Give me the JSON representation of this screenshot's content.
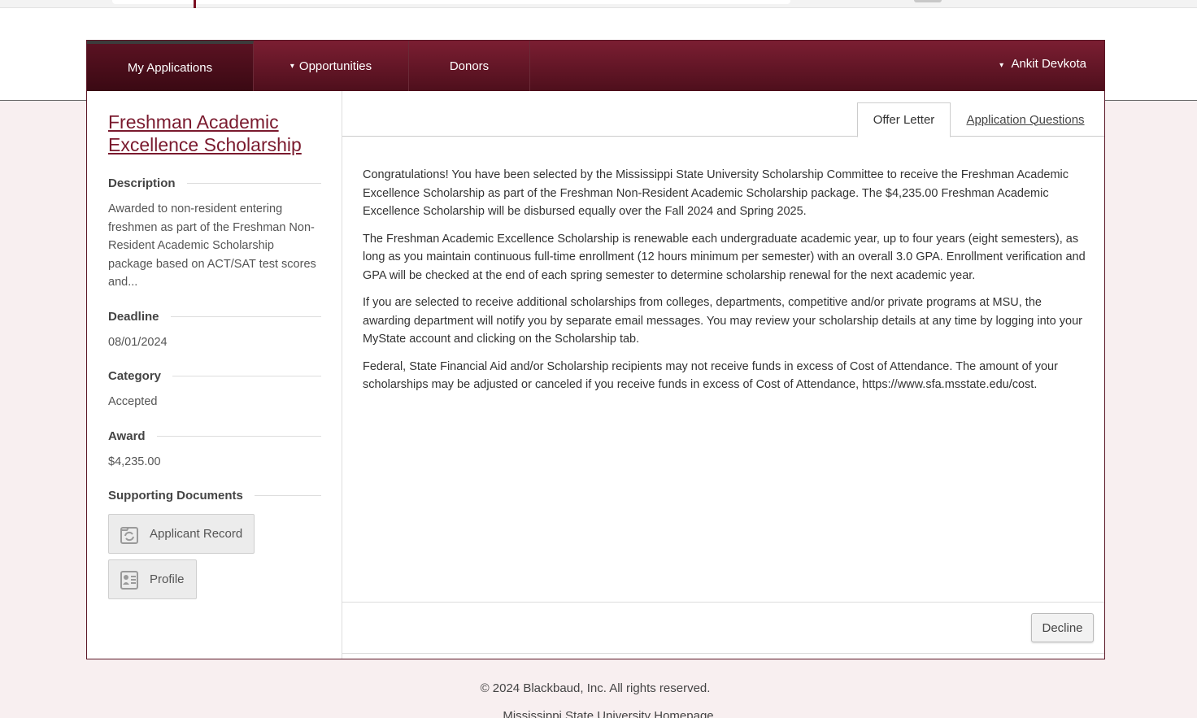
{
  "nav": {
    "items": [
      {
        "label": "My Applications",
        "dropdown": false,
        "active": true
      },
      {
        "label": "Opportunities",
        "dropdown": true,
        "active": false
      },
      {
        "label": "Donors",
        "dropdown": false,
        "active": false
      }
    ],
    "user": "Ankit Devkota",
    "caret": "▾"
  },
  "sidebar": {
    "title_line1": "Freshman Academic",
    "title_line2": "Excellence Scholarship",
    "description_heading": "Description",
    "description": "Awarded to non-resident entering freshmen as part of the Freshman Non-Resident Academic Scholarship package based on ACT/SAT test scores and...",
    "deadline_heading": "Deadline",
    "deadline": "08/01/2024",
    "category_heading": "Category",
    "category": "Accepted",
    "award_heading": "Award",
    "award": "$4,235.00",
    "docs_heading": "Supporting Documents",
    "docs": [
      "Applicant Record",
      "Profile"
    ]
  },
  "tabs": {
    "active": "Offer Letter",
    "other": "Application Questions"
  },
  "letter": {
    "p1": "Congratulations! You have been selected by the Mississippi State University Scholarship Committee to receive the Freshman Academic Excellence Scholarship as part of the Freshman Non-Resident Academic Scholarship package. The $4,235.00 Freshman Academic Excellence Scholarship will be disbursed equally over the Fall 2024 and Spring 2025.",
    "p2": "The Freshman Academic Excellence Scholarship is renewable each undergraduate academic year, up to four years (eight semesters), as long as you maintain continuous full-time enrollment (12 hours minimum per semester) with an overall 3.0 GPA. Enrollment verification and GPA will be checked at the end of each spring semester to determine scholarship renewal for the next academic year.",
    "p3": "If you are selected to receive additional scholarships from colleges, departments, competitive and/or private programs at MSU, the awarding department will notify you by separate email messages. You may review your scholarship details at any time by logging into your MyState account and clicking on the Scholarship tab.",
    "p4": "Federal, State Financial Aid and/or Scholarship recipients may not receive funds in excess of Cost of Attendance. The amount of your scholarships may be adjusted or canceled if you receive funds in excess of Cost of Attendance, https://www.sfa.msstate.edu/cost."
  },
  "actions": {
    "decline": "Decline"
  },
  "footer": {
    "copyright": "© 2024 Blackbaud, Inc. All rights reserved.",
    "homepage": "Mississippi State University Homepage"
  },
  "colors": {
    "brand": "#7b1e32",
    "background": "#f8eff0"
  }
}
